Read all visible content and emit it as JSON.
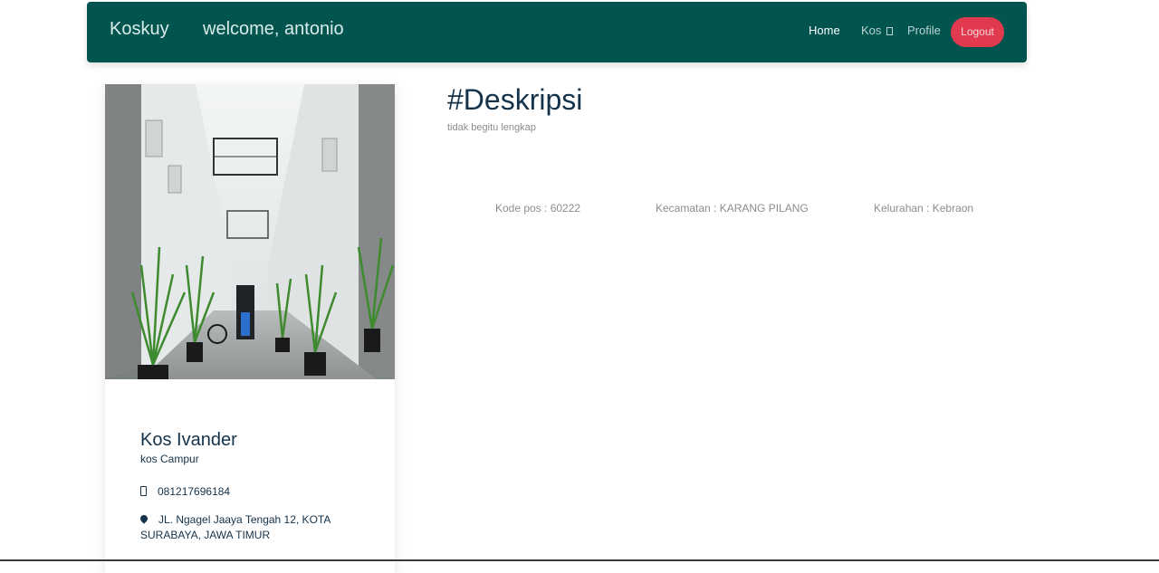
{
  "navbar": {
    "brand": "Koskuy",
    "welcome": "welcome, antonio",
    "links": {
      "home": "Home",
      "kos": "Kos",
      "profile": "Profile"
    },
    "logout": "Logout",
    "colors": {
      "background": "#02544f",
      "logout": "#e13a4f"
    }
  },
  "card": {
    "name": "Kos Ivander",
    "type": "kos Campur",
    "phone": "081217696184",
    "address": "JL. Ngagel Jaaya Tengah 12, KOTA SURABAYA, JAWA TIMUR",
    "icons": {
      "phone": "mobile-phone-icon",
      "address": "map-marker-icon"
    }
  },
  "description": {
    "title": "#Deskripsi",
    "subtitle": "tidak begitu lengkap",
    "kode_pos": "Kode pos : 60222",
    "kecamatan": "Kecamatan : KARANG PILANG",
    "kelurahan": "Kelurahan : Kebraon"
  }
}
